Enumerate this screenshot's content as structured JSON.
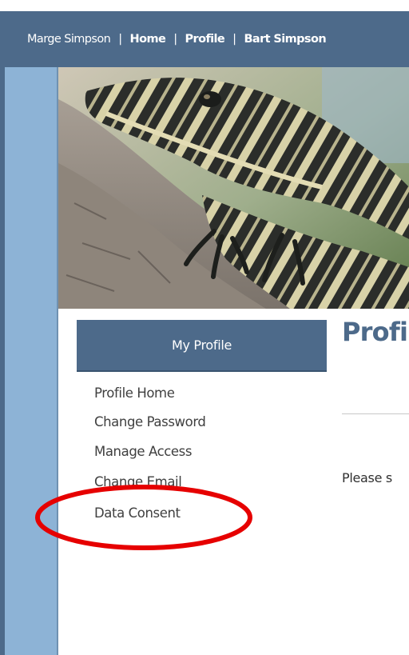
{
  "header": {
    "user_name": "Marge Simpson",
    "separator": "|",
    "nav": [
      "Home",
      "Profile",
      "Bart Simpson"
    ]
  },
  "sidebar": {
    "title": "My Profile",
    "items": [
      {
        "label": "Profile Home"
      },
      {
        "label": "Change Password"
      },
      {
        "label": "Manage Access"
      },
      {
        "label": "Change Email"
      },
      {
        "label": "Data Consent"
      }
    ]
  },
  "main": {
    "heading": "Profi",
    "body_text": "Please s"
  },
  "annotation": {
    "highlight_color": "#e60000",
    "highlighted_item": "Data Consent"
  },
  "colors": {
    "header_bg": "#4d6a8a",
    "stripe": "#8db3d6",
    "heading": "#4d6a8a"
  }
}
